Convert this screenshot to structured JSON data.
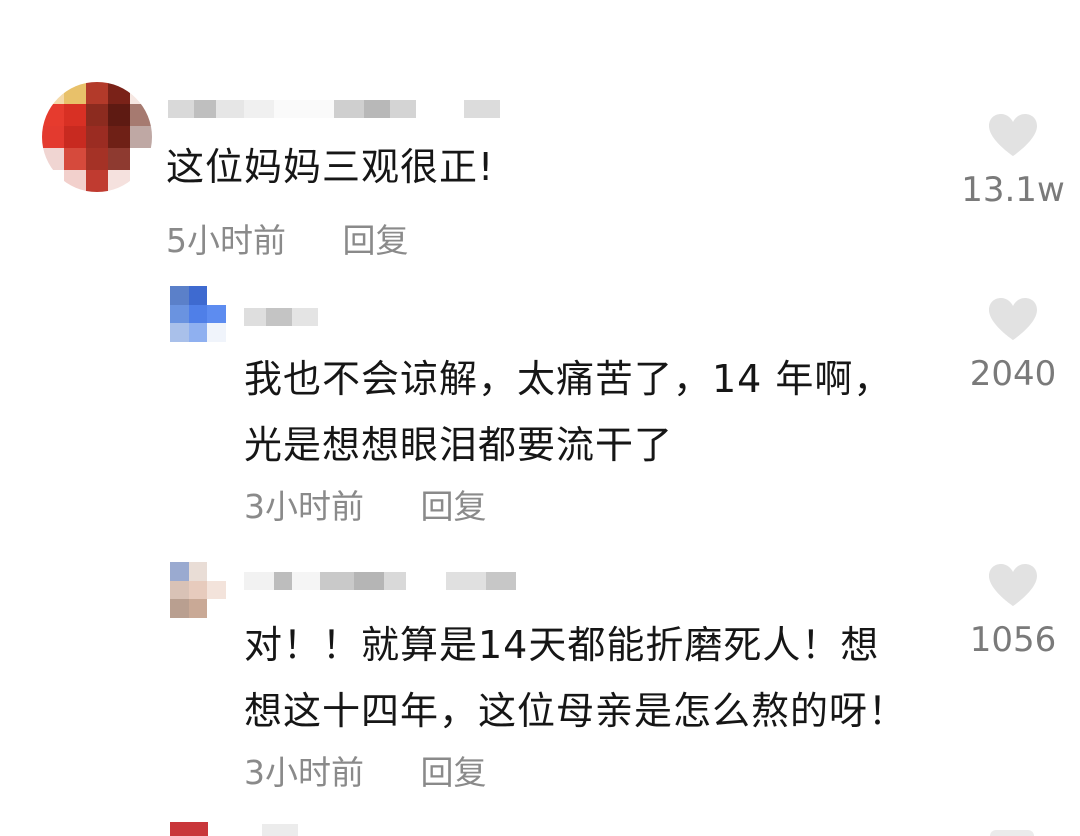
{
  "comments": [
    {
      "text_lines": [
        "这位妈妈三观很正!"
      ],
      "time": "5小时前",
      "reply": "回复",
      "likes": "13.1w"
    },
    {
      "text_lines": [
        "我也不会谅解，太痛苦了，14 年啊，",
        "光是想想眼泪都要流干了"
      ],
      "time": "3小时前",
      "reply": "回复",
      "likes": "2040"
    },
    {
      "text_lines": [
        "对！！就算是14天都能折磨死人！想",
        "想这十四年，这位母亲是怎么熬的呀！"
      ],
      "time": "3小时前",
      "reply": "回复",
      "likes": "1056"
    }
  ],
  "colors": {
    "text": "#161616",
    "meta": "#8a8a8a",
    "heart": "#e2e2e2",
    "like_count": "#7a7a7a"
  },
  "icons": [
    "heart-icon"
  ]
}
